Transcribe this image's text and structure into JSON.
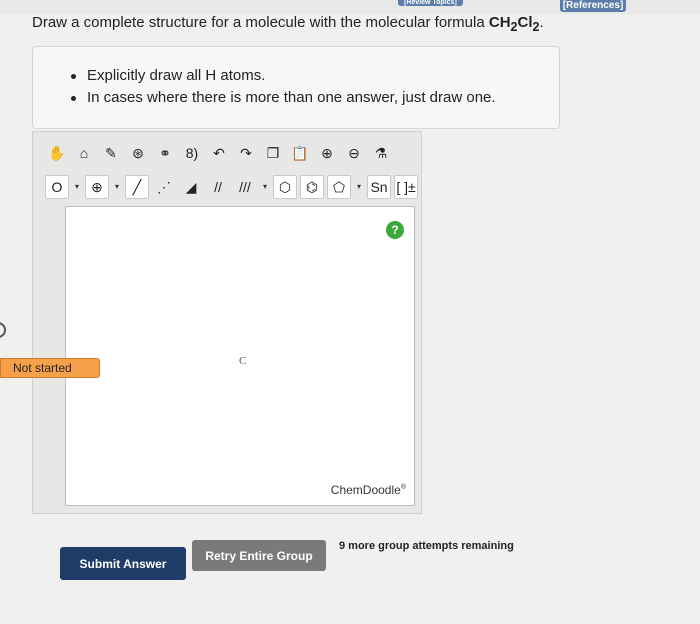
{
  "header": {
    "review_topics_label": "[Review Topics]",
    "references_label": "[References]"
  },
  "question": {
    "prompt": "Draw a complete structure for a molecule with the molecular formula ",
    "formula_main": "CH",
    "formula_sub1": "2",
    "formula_mid": "Cl",
    "formula_sub2": "2",
    "formula_end": "."
  },
  "hints": {
    "items": [
      "Explicitly draw all H atoms.",
      "In cases where there is more than one answer, just draw one."
    ]
  },
  "toolbar": {
    "row1": [
      {
        "name": "hand-icon",
        "glyph": "✋"
      },
      {
        "name": "lasso-icon",
        "glyph": "⌂"
      },
      {
        "name": "eraser-icon",
        "glyph": "✎"
      },
      {
        "name": "center-icon",
        "glyph": "⊛"
      },
      {
        "name": "template-icon",
        "glyph": "⚭"
      },
      {
        "name": "ring-template-icon",
        "glyph": "8)"
      },
      {
        "name": "undo-icon",
        "glyph": "↶"
      },
      {
        "name": "redo-icon",
        "glyph": "↷"
      },
      {
        "name": "copy-icon",
        "glyph": "❐"
      },
      {
        "name": "paste-icon",
        "glyph": "📋"
      },
      {
        "name": "zoom-in-icon",
        "glyph": "⊕"
      },
      {
        "name": "zoom-out-icon",
        "glyph": "⊖"
      },
      {
        "name": "clean-icon",
        "glyph": "⚗"
      }
    ],
    "row2": [
      {
        "name": "atom-o-icon",
        "glyph": "O"
      },
      {
        "name": "charge-plus-icon",
        "glyph": "⊕"
      },
      {
        "name": "single-bond-icon",
        "glyph": "╱"
      },
      {
        "name": "hash-bond-icon",
        "glyph": "⋰"
      },
      {
        "name": "wedge-bond-icon",
        "glyph": "◢"
      },
      {
        "name": "double-bond-icon",
        "glyph": "//"
      },
      {
        "name": "triple-bond-icon",
        "glyph": "///"
      },
      {
        "name": "ring-cyclohexane-icon",
        "glyph": "⬡"
      },
      {
        "name": "ring-benzene-icon",
        "glyph": "⌬"
      },
      {
        "name": "ring-pentagon-icon",
        "glyph": "⬠"
      },
      {
        "name": "polymer-icon",
        "glyph": "Sn"
      },
      {
        "name": "bracket-icon",
        "glyph": "[ ]±"
      }
    ]
  },
  "canvas": {
    "atom_label": "C",
    "brand": "ChemDoodle",
    "brand_mark": "®",
    "help_glyph": "?"
  },
  "status": {
    "label": "Not started"
  },
  "actions": {
    "submit_label": "Submit Answer",
    "retry_label": "Retry Entire Group",
    "attempts_text": "9 more group attempts remaining"
  }
}
